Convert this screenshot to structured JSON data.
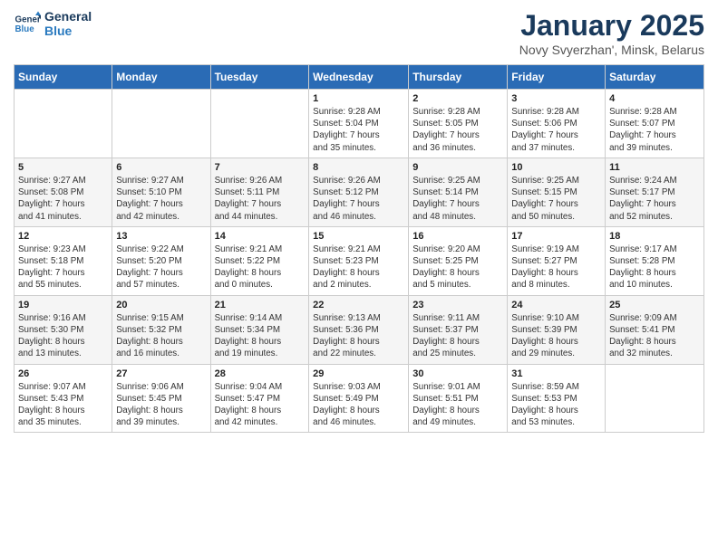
{
  "logo": {
    "line1": "General",
    "line2": "Blue"
  },
  "title": "January 2025",
  "location": "Novy Svyerzhan', Minsk, Belarus",
  "weekdays": [
    "Sunday",
    "Monday",
    "Tuesday",
    "Wednesday",
    "Thursday",
    "Friday",
    "Saturday"
  ],
  "weeks": [
    [
      {
        "day": "",
        "info": ""
      },
      {
        "day": "",
        "info": ""
      },
      {
        "day": "",
        "info": ""
      },
      {
        "day": "1",
        "info": "Sunrise: 9:28 AM\nSunset: 5:04 PM\nDaylight: 7 hours\nand 35 minutes."
      },
      {
        "day": "2",
        "info": "Sunrise: 9:28 AM\nSunset: 5:05 PM\nDaylight: 7 hours\nand 36 minutes."
      },
      {
        "day": "3",
        "info": "Sunrise: 9:28 AM\nSunset: 5:06 PM\nDaylight: 7 hours\nand 37 minutes."
      },
      {
        "day": "4",
        "info": "Sunrise: 9:28 AM\nSunset: 5:07 PM\nDaylight: 7 hours\nand 39 minutes."
      }
    ],
    [
      {
        "day": "5",
        "info": "Sunrise: 9:27 AM\nSunset: 5:08 PM\nDaylight: 7 hours\nand 41 minutes."
      },
      {
        "day": "6",
        "info": "Sunrise: 9:27 AM\nSunset: 5:10 PM\nDaylight: 7 hours\nand 42 minutes."
      },
      {
        "day": "7",
        "info": "Sunrise: 9:26 AM\nSunset: 5:11 PM\nDaylight: 7 hours\nand 44 minutes."
      },
      {
        "day": "8",
        "info": "Sunrise: 9:26 AM\nSunset: 5:12 PM\nDaylight: 7 hours\nand 46 minutes."
      },
      {
        "day": "9",
        "info": "Sunrise: 9:25 AM\nSunset: 5:14 PM\nDaylight: 7 hours\nand 48 minutes."
      },
      {
        "day": "10",
        "info": "Sunrise: 9:25 AM\nSunset: 5:15 PM\nDaylight: 7 hours\nand 50 minutes."
      },
      {
        "day": "11",
        "info": "Sunrise: 9:24 AM\nSunset: 5:17 PM\nDaylight: 7 hours\nand 52 minutes."
      }
    ],
    [
      {
        "day": "12",
        "info": "Sunrise: 9:23 AM\nSunset: 5:18 PM\nDaylight: 7 hours\nand 55 minutes."
      },
      {
        "day": "13",
        "info": "Sunrise: 9:22 AM\nSunset: 5:20 PM\nDaylight: 7 hours\nand 57 minutes."
      },
      {
        "day": "14",
        "info": "Sunrise: 9:21 AM\nSunset: 5:22 PM\nDaylight: 8 hours\nand 0 minutes."
      },
      {
        "day": "15",
        "info": "Sunrise: 9:21 AM\nSunset: 5:23 PM\nDaylight: 8 hours\nand 2 minutes."
      },
      {
        "day": "16",
        "info": "Sunrise: 9:20 AM\nSunset: 5:25 PM\nDaylight: 8 hours\nand 5 minutes."
      },
      {
        "day": "17",
        "info": "Sunrise: 9:19 AM\nSunset: 5:27 PM\nDaylight: 8 hours\nand 8 minutes."
      },
      {
        "day": "18",
        "info": "Sunrise: 9:17 AM\nSunset: 5:28 PM\nDaylight: 8 hours\nand 10 minutes."
      }
    ],
    [
      {
        "day": "19",
        "info": "Sunrise: 9:16 AM\nSunset: 5:30 PM\nDaylight: 8 hours\nand 13 minutes."
      },
      {
        "day": "20",
        "info": "Sunrise: 9:15 AM\nSunset: 5:32 PM\nDaylight: 8 hours\nand 16 minutes."
      },
      {
        "day": "21",
        "info": "Sunrise: 9:14 AM\nSunset: 5:34 PM\nDaylight: 8 hours\nand 19 minutes."
      },
      {
        "day": "22",
        "info": "Sunrise: 9:13 AM\nSunset: 5:36 PM\nDaylight: 8 hours\nand 22 minutes."
      },
      {
        "day": "23",
        "info": "Sunrise: 9:11 AM\nSunset: 5:37 PM\nDaylight: 8 hours\nand 25 minutes."
      },
      {
        "day": "24",
        "info": "Sunrise: 9:10 AM\nSunset: 5:39 PM\nDaylight: 8 hours\nand 29 minutes."
      },
      {
        "day": "25",
        "info": "Sunrise: 9:09 AM\nSunset: 5:41 PM\nDaylight: 8 hours\nand 32 minutes."
      }
    ],
    [
      {
        "day": "26",
        "info": "Sunrise: 9:07 AM\nSunset: 5:43 PM\nDaylight: 8 hours\nand 35 minutes."
      },
      {
        "day": "27",
        "info": "Sunrise: 9:06 AM\nSunset: 5:45 PM\nDaylight: 8 hours\nand 39 minutes."
      },
      {
        "day": "28",
        "info": "Sunrise: 9:04 AM\nSunset: 5:47 PM\nDaylight: 8 hours\nand 42 minutes."
      },
      {
        "day": "29",
        "info": "Sunrise: 9:03 AM\nSunset: 5:49 PM\nDaylight: 8 hours\nand 46 minutes."
      },
      {
        "day": "30",
        "info": "Sunrise: 9:01 AM\nSunset: 5:51 PM\nDaylight: 8 hours\nand 49 minutes."
      },
      {
        "day": "31",
        "info": "Sunrise: 8:59 AM\nSunset: 5:53 PM\nDaylight: 8 hours\nand 53 minutes."
      },
      {
        "day": "",
        "info": ""
      }
    ]
  ]
}
